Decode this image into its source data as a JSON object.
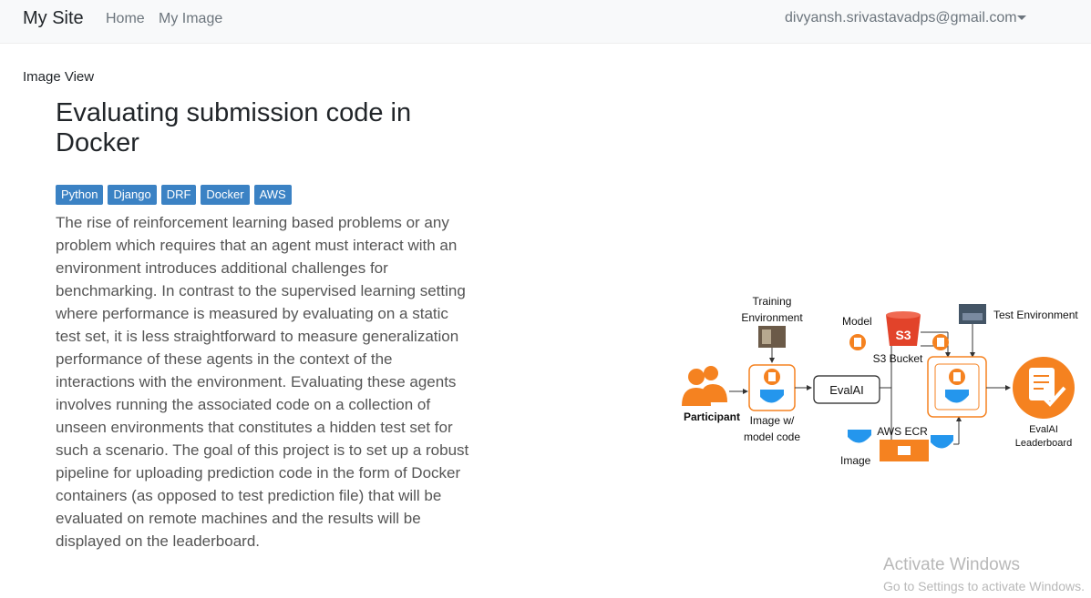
{
  "navbar": {
    "brand": "My Site",
    "links": [
      "Home",
      "My Image"
    ],
    "user_email": "divyansh.srivastavadps@gmail.com"
  },
  "page": {
    "label": "Image View",
    "title": "Evaluating submission code in Docker",
    "tags": [
      "Python",
      "Django",
      "DRF",
      "Docker",
      "AWS"
    ],
    "description": "The rise of reinforcement learning based problems or any problem which requires that an agent must interact with an environment introduces additional challenges for benchmarking. In contrast to the supervised learning setting where performance is measured by evaluating on a static test set, it is less straightforward to measure generalization performance of these agents in the context of the interactions with the environment. Evaluating these agents involves running the associated code on a collection of unseen environments that constitutes a hidden test set for such a scenario. The goal of this project is to set up a robust pipeline for uploading prediction code in the form of Docker containers (as opposed to test prediction file) that will be evaluated on remote machines and the results will be displayed on the leaderboard."
  },
  "diagram": {
    "training_env_l1": "Training",
    "training_env_l2": "Environment",
    "participant": "Participant",
    "image_code_l1": "Image w/",
    "image_code_l2": "model code",
    "evalai": "EvalAI",
    "model": "Model",
    "s3_text": "S3",
    "s3_bucket": "S3 Bucket",
    "aws_ecr": "AWS ECR",
    "image": "Image",
    "test_env": "Test Environment",
    "leaderboard_l1": "EvalAI",
    "leaderboard_l2": "Leaderboard",
    "accent_color": "#f58220"
  },
  "watermark": {
    "line1": "Activate Windows",
    "line2": "Go to Settings to activate Windows."
  }
}
